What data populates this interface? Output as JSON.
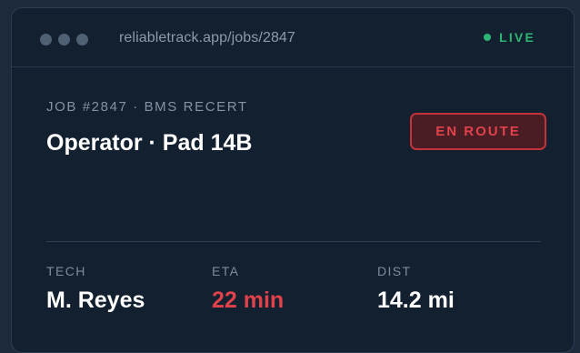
{
  "browser": {
    "url": "reliabletrack.app/jobs/2847",
    "live_label": "LIVE"
  },
  "job": {
    "eyebrow": "JOB #2847 · BMS RECERT",
    "title": "Operator · Pad 14B",
    "status": "EN ROUTE"
  },
  "stats": [
    {
      "label": "TECH",
      "value": "M. Reyes"
    },
    {
      "label": "ETA",
      "value": "22 min"
    },
    {
      "label": "DIST",
      "value": "14.2 mi"
    }
  ],
  "colors": {
    "live": "#2bb673",
    "alert": "#e0414a",
    "background": "#13202f"
  }
}
